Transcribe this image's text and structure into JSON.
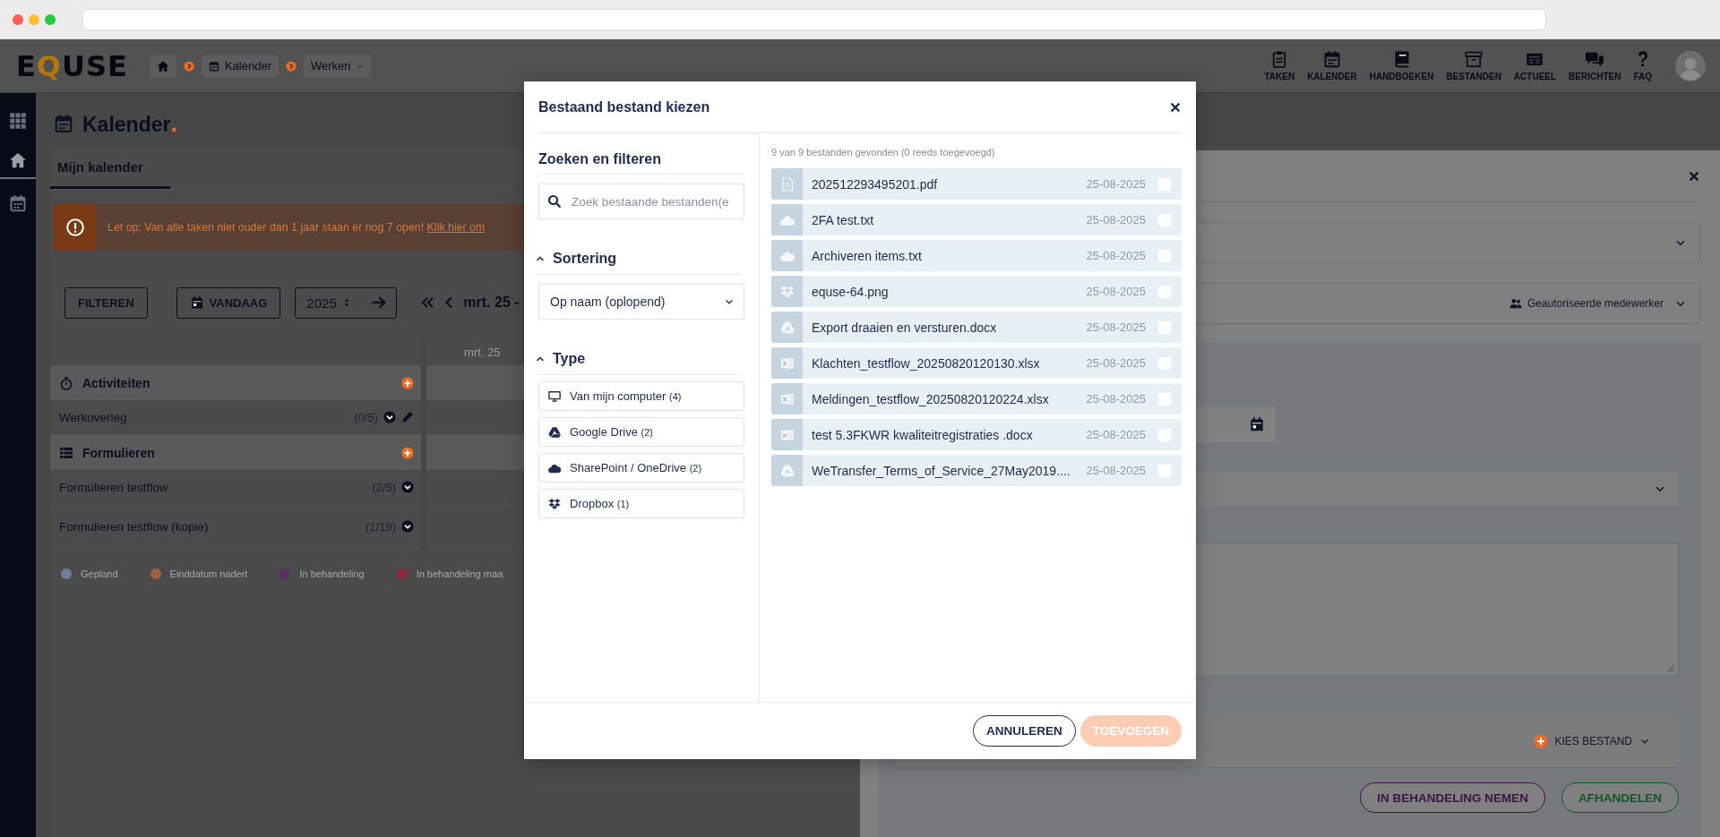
{
  "header": {
    "logo": "EQUSE",
    "breadcrumbs": [
      {
        "kind": "home"
      },
      {
        "kind": "link",
        "label": "Kalender"
      },
      {
        "kind": "dropdown",
        "label": "Werken"
      }
    ],
    "nav": [
      {
        "kind": "tasks",
        "label": "TAKEN"
      },
      {
        "kind": "calendar",
        "label": "KALENDER"
      },
      {
        "kind": "manuals",
        "label": "HANDBOEKEN"
      },
      {
        "kind": "files",
        "label": "BESTANDEN"
      },
      {
        "kind": "news",
        "label": "ACTUEEL"
      },
      {
        "kind": "messages",
        "label": "BERICHTEN"
      },
      {
        "kind": "faq",
        "label": "FAQ"
      }
    ]
  },
  "sidebar": {
    "items": [
      {
        "kind": "apps",
        "selected": false
      },
      {
        "kind": "home",
        "selected": true
      },
      {
        "kind": "calendar",
        "selected": false
      }
    ]
  },
  "page": {
    "title": "Kalender",
    "title_mark": ".",
    "tabs": [
      {
        "label": "Mijn kalender",
        "selected": true
      }
    ],
    "alert": {
      "text": "Let op: Van alle taken niet ouder dan 1 jaar staan er nog 7 open!",
      "link": "Klik hier om"
    },
    "toolbar": {
      "filter_button": "FILTEREN",
      "today_button": "VANDAAG",
      "year": "2025",
      "period": "mrt. 25 -"
    },
    "calendar": {
      "column_header": "mrt. 25",
      "groups": [
        {
          "kind": "activities",
          "label": "Activiteiten",
          "items": [
            {
              "label": "Werkoverleg",
              "count": "(0/5)",
              "editable": true
            }
          ]
        },
        {
          "kind": "forms",
          "label": "Formulieren",
          "items": [
            {
              "label": "Formulieren testflow",
              "count": "(2/5)",
              "editable": false
            },
            {
              "label": "Formulieren testflow (kopie)",
              "count": "(1/19)",
              "editable": false
            }
          ]
        }
      ],
      "legend": [
        {
          "label": "Gepland",
          "color": "#6c7f9e"
        },
        {
          "label": "Einddatum nadert",
          "color": "#a0603e"
        },
        {
          "label": "In behandeling",
          "color": "#5a2f66"
        },
        {
          "label": "In behandeling maa",
          "color": "#8e2a3c"
        }
      ]
    }
  },
  "drawer": {
    "assignee": "Geautoriseerde medewerker",
    "attach_button": "KIES BESTAND",
    "buttons": [
      {
        "label": "IN BEHANDELING NEMEN",
        "color": "#3e1248"
      },
      {
        "label": "AFHANDELEN",
        "color": "#0f5a22"
      }
    ]
  },
  "modal": {
    "title": "Bestaand bestand kiezen",
    "filter": {
      "heading": "Zoeken en filteren",
      "search_placeholder": "Zoek bestaande bestanden(e",
      "sorting": {
        "title": "Sortering",
        "expanded": true,
        "value": "Op naam (oplopend)"
      },
      "type": {
        "title": "Type",
        "expanded": true,
        "options": [
          {
            "kind": "computer",
            "label": "Van mijn computer",
            "count": "(4)"
          },
          {
            "kind": "gdrive",
            "label": "Google Drive",
            "count": "(2)"
          },
          {
            "kind": "onedrive",
            "label": "SharePoint / OneDrive",
            "count": "(2)"
          },
          {
            "kind": "dropbox",
            "label": "Dropbox",
            "count": "(1)"
          }
        ]
      }
    },
    "summary": "9 van 9 bestanden gevonden (0 reeds toegevoegd)",
    "files": [
      {
        "kind": "pdf",
        "name": "202512293495201.pdf",
        "date": "25-08-2025",
        "checked": false
      },
      {
        "kind": "onedrive",
        "name": "2FA test.txt",
        "date": "25-08-2025",
        "checked": false
      },
      {
        "kind": "onedrive",
        "name": "Archiveren items.txt",
        "date": "25-08-2025",
        "checked": false
      },
      {
        "kind": "dropbox",
        "name": "equse-64.png",
        "date": "25-08-2025",
        "checked": false
      },
      {
        "kind": "gdrive",
        "name": "Export draaien en versturen.docx",
        "date": "25-08-2025",
        "checked": false
      },
      {
        "kind": "excel",
        "name": "Klachten_testflow_20250820120130.xlsx",
        "date": "25-08-2025",
        "checked": false
      },
      {
        "kind": "excel",
        "name": "Meldingen_testflow_20250820120224.xlsx",
        "date": "25-08-2025",
        "checked": false
      },
      {
        "kind": "word",
        "name": "test 5.3FKWR kwaliteitregistraties .docx",
        "date": "25-08-2025",
        "checked": false
      },
      {
        "kind": "gdrive",
        "name": "WeTransfer_Terms_of_Service_27May2019....",
        "date": "25-08-2025",
        "checked": false
      }
    ],
    "buttons": [
      {
        "kind": "outline",
        "label": "ANNULEREN",
        "disabled": false
      },
      {
        "kind": "primary",
        "label": "TOEVOEGEN",
        "disabled": true
      }
    ]
  }
}
